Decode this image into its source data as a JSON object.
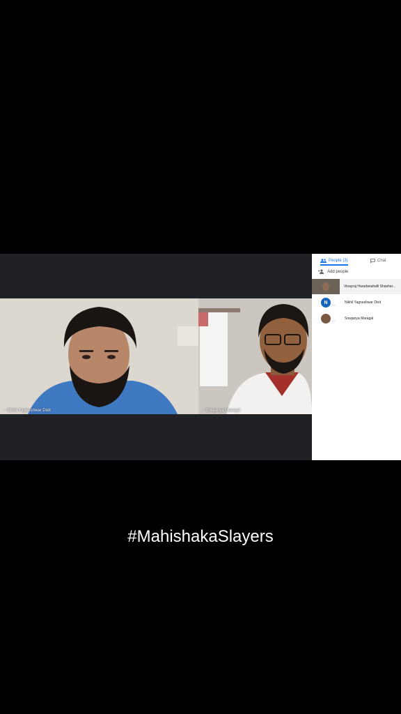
{
  "caption": "#MahishakaSlayers",
  "meeting": {
    "tiles": [
      {
        "name": "Nikhil Yagneshwar Dixit"
      },
      {
        "name": "Sowjanya Maragal"
      }
    ]
  },
  "panel": {
    "tabs": [
      {
        "label": "People (3)",
        "icon": "people-icon",
        "active": true
      },
      {
        "label": "Chat",
        "icon": "chat-icon",
        "active": false
      }
    ],
    "add_people_label": "Add people",
    "participants": [
      {
        "name": "Vinayraj Haradanahalli Shashar..."
      },
      {
        "name": "Nikhil Yagneshwar Dixit",
        "initial": "N"
      },
      {
        "name": "Sowjanya Maragal"
      }
    ]
  },
  "colors": {
    "accent": "#1a73e8",
    "background": "#000000",
    "meeting_bg": "#202124"
  }
}
